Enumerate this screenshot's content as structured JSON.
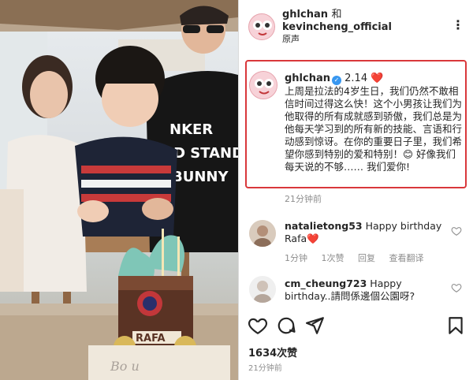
{
  "post": {
    "author_1": "ghlchan",
    "conjunction": "和",
    "author_2": "kevincheng_official",
    "audio_label": "原声",
    "more_glyph": "⋮"
  },
  "caption": {
    "username": "ghlchan",
    "date": "2.14",
    "heart": "❤️",
    "text": "上周是拉法的4岁生日，我们仍然不敢相信时间过得这么快！这个小男孩让我们为他取得的所有成就感到骄傲，我们总是为他每天学习到的所有新的技能、言语和行动感到惊讶。在你的重要日子里，我们希望你感到特别的爱和特别！😊 好像我们每天说的不够…… 我们爱你!",
    "time": "21分钟前"
  },
  "comments": [
    {
      "username": "natalietong53",
      "text": "Happy birthday Rafa❤️",
      "time": "1分钟",
      "likes": "1次赞",
      "reply": "回复",
      "translate": "查看翻译"
    },
    {
      "username": "cm_cheung723",
      "text": "Happy birthday..請問係邊個公園呀?",
      "time": "",
      "likes": "",
      "reply": "",
      "translate": ""
    }
  ],
  "footer": {
    "likes": "1634次赞",
    "time": "21分钟前"
  },
  "photo": {
    "shirt_text": "NKER ND STAND BUNNY",
    "cake_text": "RAFA"
  },
  "colors": {
    "highlight_box": "#d9383b",
    "verified": "#3897f0",
    "heart": "#e0262f",
    "muted_text": "#8e8e8e"
  },
  "icons": [
    "heart-icon",
    "comment-icon",
    "share-icon",
    "bookmark-icon",
    "more-icon",
    "verified-icon"
  ]
}
